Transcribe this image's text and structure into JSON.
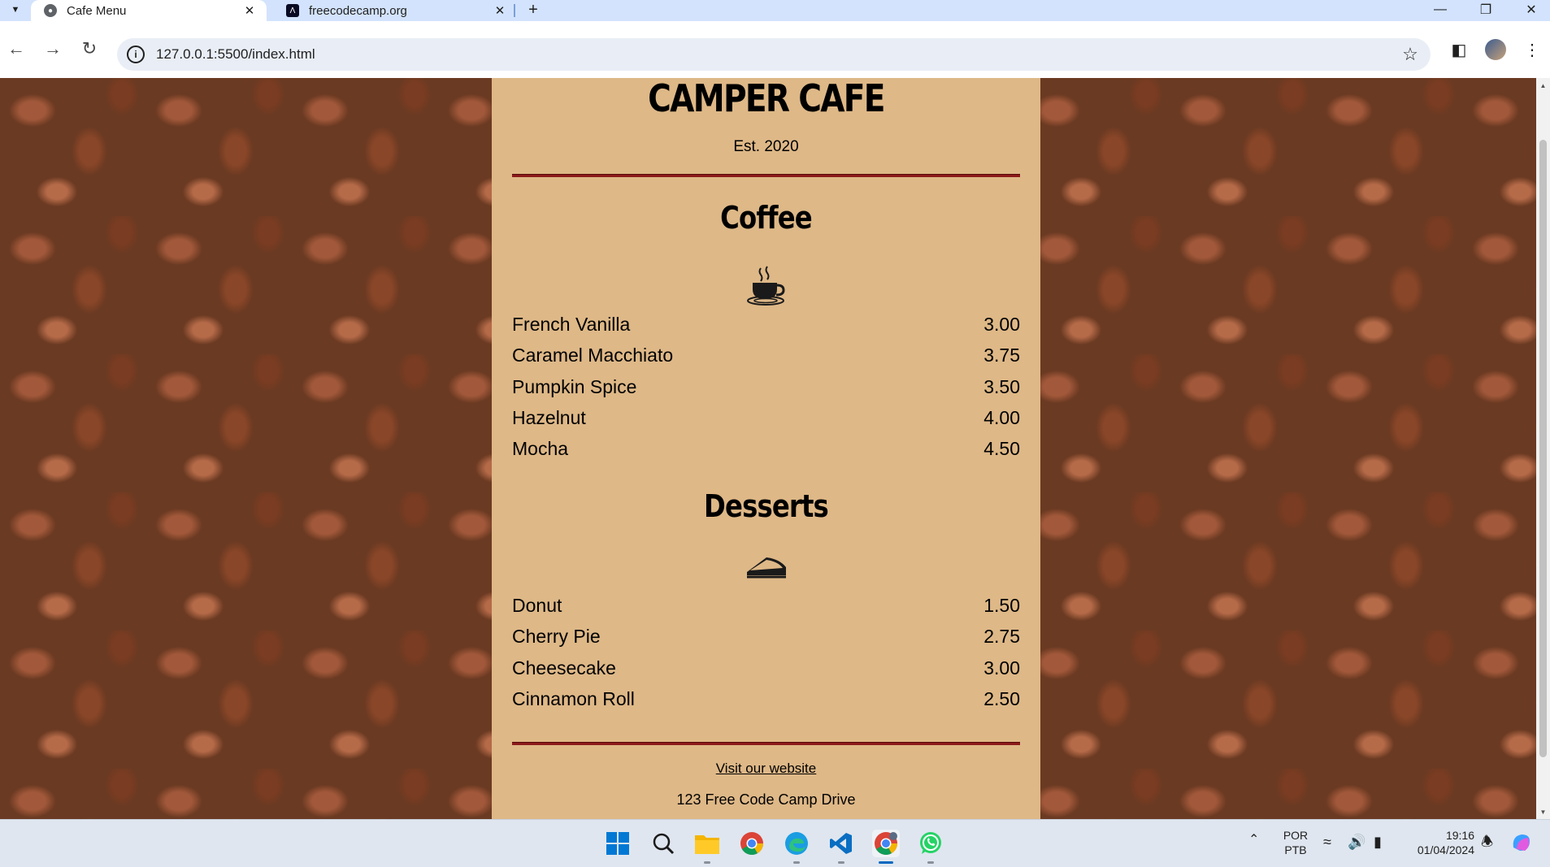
{
  "browser": {
    "tabs": [
      {
        "title": "Cafe Menu",
        "active": true
      },
      {
        "title": "freecodecamp.org",
        "active": false
      }
    ],
    "url": "127.0.0.1:5500/index.html"
  },
  "menu": {
    "title": "CAMPER CAFE",
    "established": "Est. 2020",
    "sections": [
      {
        "heading": "Coffee",
        "icon": "coffee-cup-icon",
        "items": [
          {
            "name": "French Vanilla",
            "price": "3.00"
          },
          {
            "name": "Caramel Macchiato",
            "price": "3.75"
          },
          {
            "name": "Pumpkin Spice",
            "price": "3.50"
          },
          {
            "name": "Hazelnut",
            "price": "4.00"
          },
          {
            "name": "Mocha",
            "price": "4.50"
          }
        ]
      },
      {
        "heading": "Desserts",
        "icon": "pie-slice-icon",
        "items": [
          {
            "name": "Donut",
            "price": "1.50"
          },
          {
            "name": "Cherry Pie",
            "price": "2.75"
          },
          {
            "name": "Cheesecake",
            "price": "3.00"
          },
          {
            "name": "Cinnamon Roll",
            "price": "2.50"
          }
        ]
      }
    ],
    "footer": {
      "link_text": "Visit our website",
      "address": "123 Free Code Camp Drive"
    }
  },
  "taskbar": {
    "language": "POR",
    "keyboard": "PTB",
    "time": "19:16",
    "date": "01/04/2024"
  },
  "colors": {
    "menu_background": "#deb887",
    "rule": "#8b1a1a",
    "tabstrip": "#d3e3fd"
  }
}
